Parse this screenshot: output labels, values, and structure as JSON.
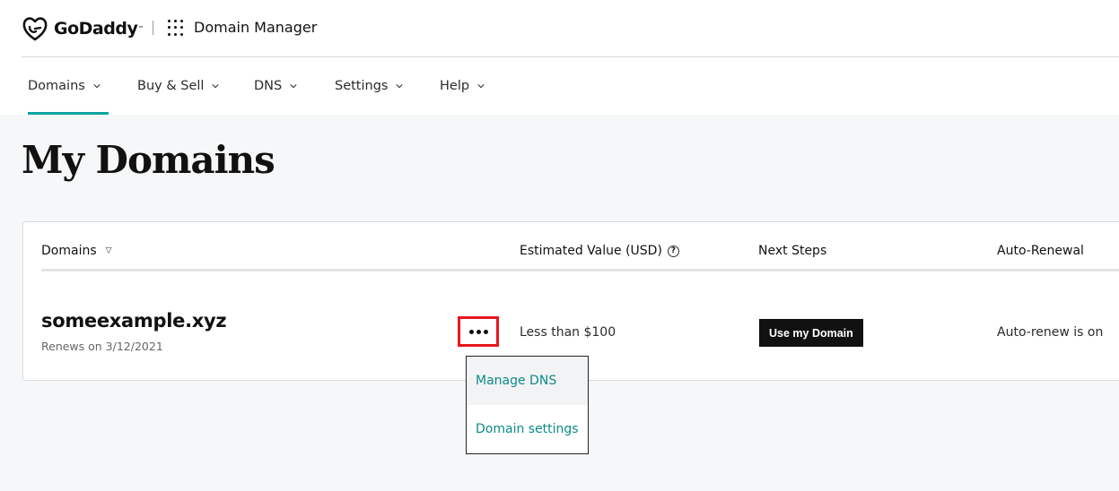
{
  "header": {
    "brand": "GoDaddy",
    "product_title": "Domain Manager"
  },
  "nav": {
    "items": [
      {
        "label": "Domains",
        "active": true
      },
      {
        "label": "Buy & Sell"
      },
      {
        "label": "DNS"
      },
      {
        "label": "Settings"
      },
      {
        "label": "Help"
      }
    ]
  },
  "main": {
    "title": "My Domains",
    "table": {
      "columns": [
        "Domains",
        "Estimated Value (USD)",
        "Next Steps",
        "Auto-Renewal"
      ],
      "rows": [
        {
          "domain": "someexample.xyz",
          "renewal": "Renews on 3/12/2021",
          "estimated_value": "Less than $100",
          "next_step_button": "Use my Domain",
          "auto_renewal": "Auto-renew is on"
        }
      ]
    },
    "menu": {
      "items": [
        "Manage DNS",
        "Domain settings"
      ]
    }
  },
  "colors": {
    "accent": "#09a4a1",
    "link": "#0d8a8a",
    "highlight": "#e8161e",
    "background": "#f5f7f8"
  },
  "icons": [
    "godaddy-logo-icon",
    "apps-grid-icon",
    "chevron-down-icon",
    "sort-arrow-icon",
    "help-circle-icon",
    "more-dots-icon"
  ]
}
